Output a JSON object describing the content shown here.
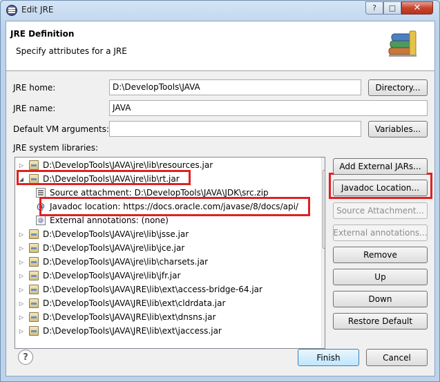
{
  "window": {
    "title": "Edit JRE",
    "controls": {
      "help": "?",
      "maximize": "□",
      "close": "✕"
    }
  },
  "banner": {
    "title": "JRE Definition",
    "description": "Specify attributes for a JRE"
  },
  "form": {
    "jre_home_label": "JRE home:",
    "jre_home_value": "D:\\DevelopTools\\JAVA",
    "directory_button": "Directory...",
    "jre_name_label": "JRE name:",
    "jre_name_value": "JAVA",
    "vm_args_label": "Default VM arguments:",
    "vm_args_value": "",
    "variables_button": "Variables...",
    "libraries_label": "JRE system libraries:"
  },
  "libraries": {
    "row0": "D:\\DevelopTools\\JAVA\\jre\\lib\\resources.jar",
    "row1": "D:\\DevelopTools\\JAVA\\jre\\lib\\rt.jar",
    "row2": "Source attachment: D:\\DevelopTools\\JAVA\\JDK\\src.zip",
    "row3": "Javadoc location: https://docs.oracle.com/javase/8/docs/api/",
    "row4": "External annotations: (none)",
    "row5": "D:\\DevelopTools\\JAVA\\jre\\lib\\jsse.jar",
    "row6": "D:\\DevelopTools\\JAVA\\jre\\lib\\jce.jar",
    "row7": "D:\\DevelopTools\\JAVA\\jre\\lib\\charsets.jar",
    "row8": "D:\\DevelopTools\\JAVA\\jre\\lib\\jfr.jar",
    "row9": "D:\\DevelopTools\\JAVA\\JRE\\lib\\ext\\access-bridge-64.jar",
    "row10": "D:\\DevelopTools\\JAVA\\JRE\\lib\\ext\\cldrdata.jar",
    "row11": "D:\\DevelopTools\\JAVA\\JRE\\lib\\ext\\dnsns.jar",
    "row12": "D:\\DevelopTools\\JAVA\\JRE\\lib\\ext\\jaccess.jar"
  },
  "side_buttons": {
    "add_external_jars": "Add External JARs...",
    "javadoc_location": "Javadoc Location...",
    "source_attachment": "Source Attachment...",
    "external_annotations": "External annotations...",
    "remove": "Remove",
    "up": "Up",
    "down": "Down",
    "restore_default": "Restore Default"
  },
  "footer": {
    "help": "?",
    "finish": "Finish",
    "cancel": "Cancel"
  },
  "colors": {
    "highlight_box": "#e02020",
    "window_frame": "#c9dcef"
  }
}
